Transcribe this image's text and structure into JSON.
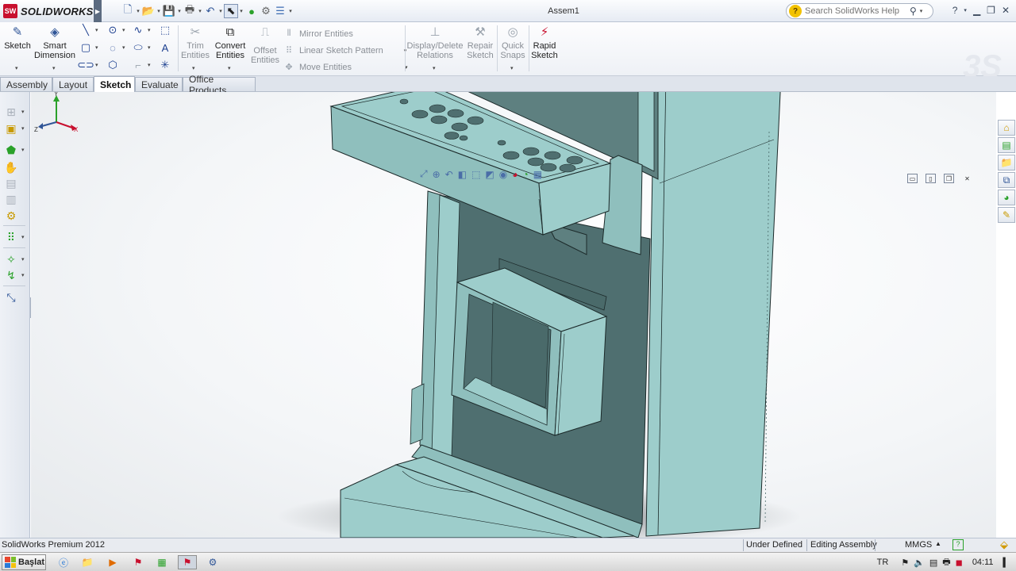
{
  "app": {
    "brand": "SOLIDWORKS",
    "brand_badge": "SW",
    "document_title": "Assem1"
  },
  "quick_access": [
    {
      "name": "new-document-icon",
      "glyph": "🗋"
    },
    {
      "name": "open-folder-icon",
      "glyph": "📂"
    },
    {
      "name": "save-icon",
      "glyph": "💾"
    },
    {
      "name": "print-icon",
      "glyph": "🖶"
    },
    {
      "name": "undo-icon",
      "glyph": "↶"
    },
    {
      "name": "select-pointer-icon",
      "glyph": "⬉"
    },
    {
      "name": "traffic-light-icon",
      "glyph": "●"
    },
    {
      "name": "options-icon",
      "glyph": "⚙"
    },
    {
      "name": "file-properties-icon",
      "glyph": "☰"
    }
  ],
  "search": {
    "placeholder": "Search SolidWorks Help"
  },
  "ribbon": {
    "sketch": "Sketch",
    "smart_dimension_1": "Smart",
    "smart_dimension_2": "Dimension",
    "trim_1": "Trim",
    "trim_2": "Entities",
    "convert_1": "Convert",
    "convert_2": "Entities",
    "offset_1": "Offset",
    "offset_2": "Entities",
    "mirror": "Mirror Entities",
    "linear_pattern": "Linear Sketch Pattern",
    "move": "Move Entities",
    "relations_1": "Display/Delete",
    "relations_2": "Relations",
    "repair_1": "Repair",
    "repair_2": "Sketch",
    "quick_snaps_1": "Quick",
    "quick_snaps_2": "Snaps",
    "rapid_1": "Rapid",
    "rapid_2": "Sketch"
  },
  "tabs": [
    {
      "label": "Assembly",
      "active": false
    },
    {
      "label": "Layout",
      "active": false
    },
    {
      "label": "Sketch",
      "active": true
    },
    {
      "label": "Evaluate",
      "active": false
    },
    {
      "label": "Office Products",
      "active": false
    }
  ],
  "triad": {
    "x": "X",
    "y": "Y",
    "z": "Z"
  },
  "status": {
    "product": "SolidWorks Premium 2012",
    "definition": "Under Defined",
    "mode": "Editing Assembly",
    "units": "MMGS"
  },
  "taskbar": {
    "start_label": "Başlat",
    "language": "TR",
    "clock": "04:11"
  },
  "colors": {
    "model_face": "#9dcdcb",
    "model_shadow": "#4f6f70",
    "model_dark": "#5e8080",
    "edge": "#1c2a2a",
    "brand_red": "#c8102e"
  }
}
